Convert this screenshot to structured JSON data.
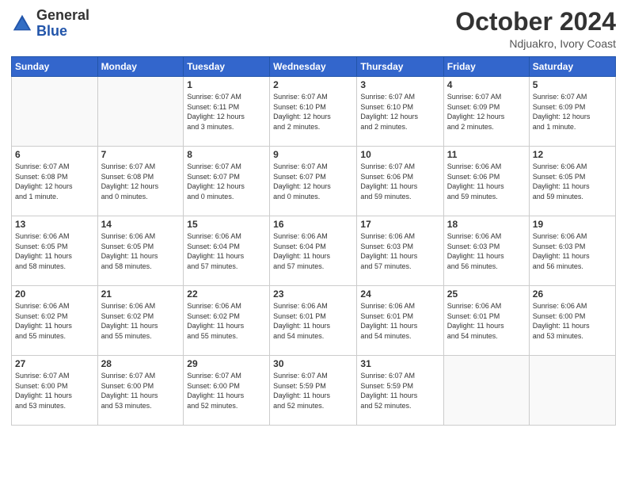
{
  "header": {
    "logo": {
      "text_general": "General",
      "text_blue": "Blue"
    },
    "title": "October 2024",
    "location": "Ndjuakro, Ivory Coast"
  },
  "calendar": {
    "weekdays": [
      "Sunday",
      "Monday",
      "Tuesday",
      "Wednesday",
      "Thursday",
      "Friday",
      "Saturday"
    ],
    "weeks": [
      [
        {
          "day": "",
          "info": ""
        },
        {
          "day": "",
          "info": ""
        },
        {
          "day": "1",
          "info": "Sunrise: 6:07 AM\nSunset: 6:11 PM\nDaylight: 12 hours\nand 3 minutes."
        },
        {
          "day": "2",
          "info": "Sunrise: 6:07 AM\nSunset: 6:10 PM\nDaylight: 12 hours\nand 2 minutes."
        },
        {
          "day": "3",
          "info": "Sunrise: 6:07 AM\nSunset: 6:10 PM\nDaylight: 12 hours\nand 2 minutes."
        },
        {
          "day": "4",
          "info": "Sunrise: 6:07 AM\nSunset: 6:09 PM\nDaylight: 12 hours\nand 2 minutes."
        },
        {
          "day": "5",
          "info": "Sunrise: 6:07 AM\nSunset: 6:09 PM\nDaylight: 12 hours\nand 1 minute."
        }
      ],
      [
        {
          "day": "6",
          "info": "Sunrise: 6:07 AM\nSunset: 6:08 PM\nDaylight: 12 hours\nand 1 minute."
        },
        {
          "day": "7",
          "info": "Sunrise: 6:07 AM\nSunset: 6:08 PM\nDaylight: 12 hours\nand 0 minutes."
        },
        {
          "day": "8",
          "info": "Sunrise: 6:07 AM\nSunset: 6:07 PM\nDaylight: 12 hours\nand 0 minutes."
        },
        {
          "day": "9",
          "info": "Sunrise: 6:07 AM\nSunset: 6:07 PM\nDaylight: 12 hours\nand 0 minutes."
        },
        {
          "day": "10",
          "info": "Sunrise: 6:07 AM\nSunset: 6:06 PM\nDaylight: 11 hours\nand 59 minutes."
        },
        {
          "day": "11",
          "info": "Sunrise: 6:06 AM\nSunset: 6:06 PM\nDaylight: 11 hours\nand 59 minutes."
        },
        {
          "day": "12",
          "info": "Sunrise: 6:06 AM\nSunset: 6:05 PM\nDaylight: 11 hours\nand 59 minutes."
        }
      ],
      [
        {
          "day": "13",
          "info": "Sunrise: 6:06 AM\nSunset: 6:05 PM\nDaylight: 11 hours\nand 58 minutes."
        },
        {
          "day": "14",
          "info": "Sunrise: 6:06 AM\nSunset: 6:05 PM\nDaylight: 11 hours\nand 58 minutes."
        },
        {
          "day": "15",
          "info": "Sunrise: 6:06 AM\nSunset: 6:04 PM\nDaylight: 11 hours\nand 57 minutes."
        },
        {
          "day": "16",
          "info": "Sunrise: 6:06 AM\nSunset: 6:04 PM\nDaylight: 11 hours\nand 57 minutes."
        },
        {
          "day": "17",
          "info": "Sunrise: 6:06 AM\nSunset: 6:03 PM\nDaylight: 11 hours\nand 57 minutes."
        },
        {
          "day": "18",
          "info": "Sunrise: 6:06 AM\nSunset: 6:03 PM\nDaylight: 11 hours\nand 56 minutes."
        },
        {
          "day": "19",
          "info": "Sunrise: 6:06 AM\nSunset: 6:03 PM\nDaylight: 11 hours\nand 56 minutes."
        }
      ],
      [
        {
          "day": "20",
          "info": "Sunrise: 6:06 AM\nSunset: 6:02 PM\nDaylight: 11 hours\nand 55 minutes."
        },
        {
          "day": "21",
          "info": "Sunrise: 6:06 AM\nSunset: 6:02 PM\nDaylight: 11 hours\nand 55 minutes."
        },
        {
          "day": "22",
          "info": "Sunrise: 6:06 AM\nSunset: 6:02 PM\nDaylight: 11 hours\nand 55 minutes."
        },
        {
          "day": "23",
          "info": "Sunrise: 6:06 AM\nSunset: 6:01 PM\nDaylight: 11 hours\nand 54 minutes."
        },
        {
          "day": "24",
          "info": "Sunrise: 6:06 AM\nSunset: 6:01 PM\nDaylight: 11 hours\nand 54 minutes."
        },
        {
          "day": "25",
          "info": "Sunrise: 6:06 AM\nSunset: 6:01 PM\nDaylight: 11 hours\nand 54 minutes."
        },
        {
          "day": "26",
          "info": "Sunrise: 6:06 AM\nSunset: 6:00 PM\nDaylight: 11 hours\nand 53 minutes."
        }
      ],
      [
        {
          "day": "27",
          "info": "Sunrise: 6:07 AM\nSunset: 6:00 PM\nDaylight: 11 hours\nand 53 minutes."
        },
        {
          "day": "28",
          "info": "Sunrise: 6:07 AM\nSunset: 6:00 PM\nDaylight: 11 hours\nand 53 minutes."
        },
        {
          "day": "29",
          "info": "Sunrise: 6:07 AM\nSunset: 6:00 PM\nDaylight: 11 hours\nand 52 minutes."
        },
        {
          "day": "30",
          "info": "Sunrise: 6:07 AM\nSunset: 5:59 PM\nDaylight: 11 hours\nand 52 minutes."
        },
        {
          "day": "31",
          "info": "Sunrise: 6:07 AM\nSunset: 5:59 PM\nDaylight: 11 hours\nand 52 minutes."
        },
        {
          "day": "",
          "info": ""
        },
        {
          "day": "",
          "info": ""
        }
      ]
    ]
  }
}
